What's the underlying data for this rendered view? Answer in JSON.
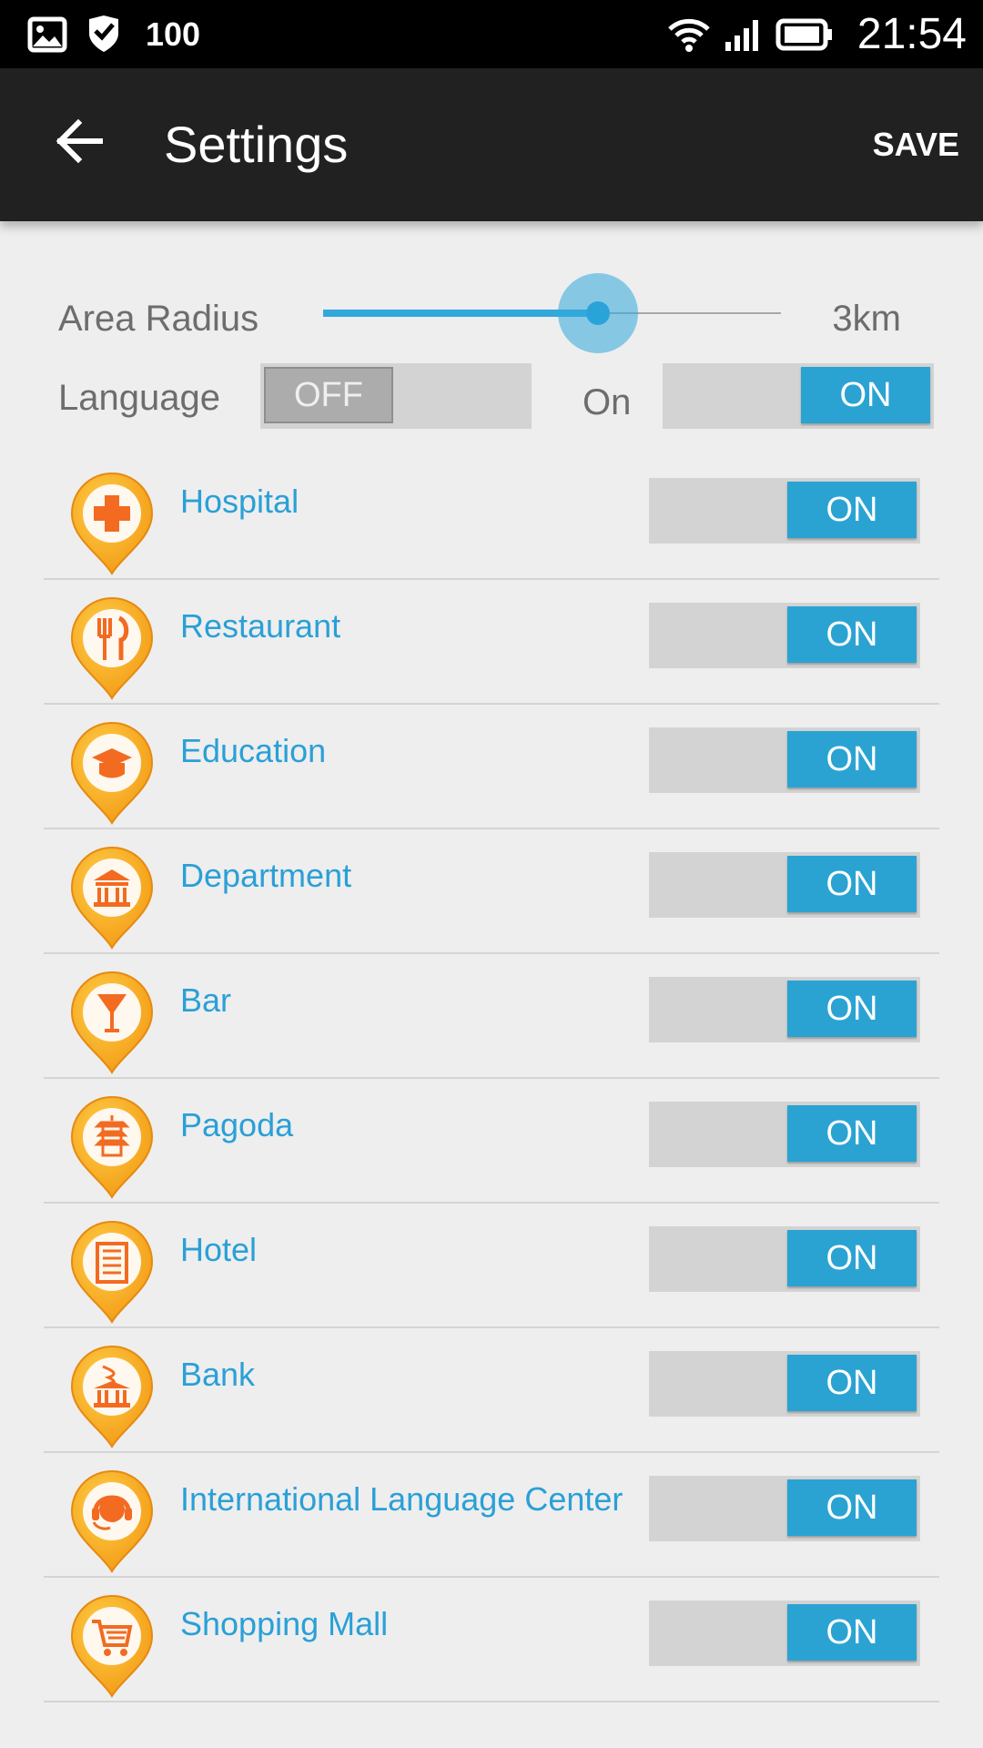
{
  "status_bar": {
    "battery_level_text": "100",
    "clock": "21:54",
    "icons": [
      "gallery-icon",
      "shield-icon",
      "wifi-icon",
      "signal-icon",
      "battery-icon"
    ]
  },
  "app_bar": {
    "title": "Settings",
    "save_label": "SAVE",
    "back_icon": "arrow-left-icon"
  },
  "area_radius": {
    "label": "Area Radius",
    "value_text": "3km",
    "slider_level": 0.6
  },
  "language": {
    "label": "Language",
    "toggle_off_label": "OFF",
    "status_text": "On",
    "toggle_on_label": "ON"
  },
  "categories": [
    {
      "label": "Hospital",
      "toggle": "ON",
      "icon": "hospital-icon"
    },
    {
      "label": "Restaurant",
      "toggle": "ON",
      "icon": "restaurant-icon"
    },
    {
      "label": "Education",
      "toggle": "ON",
      "icon": "education-icon"
    },
    {
      "label": "Department",
      "toggle": "ON",
      "icon": "department-icon"
    },
    {
      "label": "Bar",
      "toggle": "ON",
      "icon": "bar-icon"
    },
    {
      "label": "Pagoda",
      "toggle": "ON",
      "icon": "pagoda-icon"
    },
    {
      "label": "Hotel",
      "toggle": "ON",
      "icon": "hotel-icon"
    },
    {
      "label": "Bank",
      "toggle": "ON",
      "icon": "bank-icon"
    },
    {
      "label": "International Language Center",
      "toggle": "ON",
      "icon": "language-center-icon"
    },
    {
      "label": "Shopping Mall",
      "toggle": "ON",
      "icon": "shopping-mall-icon"
    }
  ],
  "colors": {
    "accent": "#2aa3d3",
    "label_blue": "#2aa0d6",
    "pin_orange": "#f7a11d",
    "pin_symbol": "#f26b21",
    "app_bar": "#212121"
  }
}
